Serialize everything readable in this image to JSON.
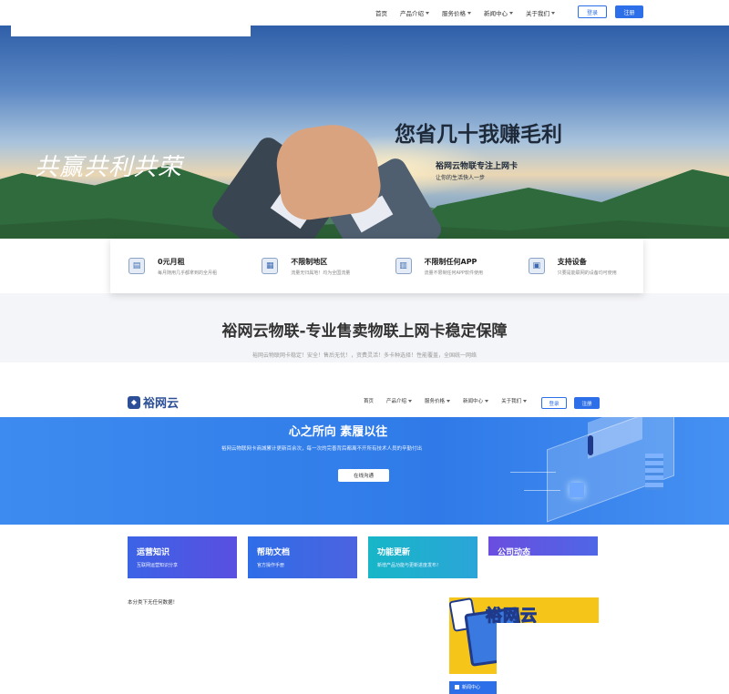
{
  "nav1": {
    "items": [
      {
        "label": "首页",
        "dropdown": false
      },
      {
        "label": "产品介绍",
        "dropdown": true
      },
      {
        "label": "服务价格",
        "dropdown": true
      },
      {
        "label": "新闻中心",
        "dropdown": true
      },
      {
        "label": "关于我们",
        "dropdown": true
      }
    ],
    "login": "登录",
    "register": "注册"
  },
  "hero": {
    "calligraphy": "共赢共利共荣",
    "title": "您省几十我赚毛利",
    "subtitle": "裕网云物联专注上网卡",
    "tagline": "让你的生活快人一步"
  },
  "features": [
    {
      "title": "0元月租",
      "desc": "每月随用几乎都拿到的全月租",
      "icon": "card-icon"
    },
    {
      "title": "不限制地区",
      "desc": "流量无归属地！均为全国流量",
      "icon": "map-icon"
    },
    {
      "title": "不限制任何APP",
      "desc": "流量不限制任何APP软件使用",
      "icon": "app-icon"
    },
    {
      "title": "支持设备",
      "desc": "只要是能联网的设备均可使用",
      "icon": "device-icon"
    }
  ],
  "slogan": {
    "title": "裕网云物联-专业售卖物联上网卡稳定保障",
    "subtitle": "裕网云物联网卡稳定！安全！售后无忧！，资费灵活！多卡种选择！性能覆盖，全国统一网络"
  },
  "site2": {
    "logo": "裕网云",
    "nav": [
      {
        "label": "首页",
        "dropdown": false
      },
      {
        "label": "产品介绍",
        "dropdown": true
      },
      {
        "label": "服务价格",
        "dropdown": true
      },
      {
        "label": "新闻中心",
        "dropdown": true
      },
      {
        "label": "关于我们",
        "dropdown": true
      }
    ],
    "login": "登录",
    "register": "注册",
    "banner": {
      "title": "心之所向 素履以往",
      "desc": "裕网云物联网卡商城累计更新百余次，每一次的完善背后都离不开所有技术人员的辛勤付出",
      "button": "在线沟通"
    },
    "cards": [
      {
        "title": "运营知识",
        "desc": "互联网运营知识分享"
      },
      {
        "title": "帮助文档",
        "desc": "官方操作手册"
      },
      {
        "title": "功能更新",
        "desc": "新增产品功能与更新进度发布！"
      },
      {
        "title": "公司动态",
        "desc": ""
      }
    ],
    "empty_notice": "本分类下无任何数据！",
    "ad_text": "裕网云",
    "ad_footer": "新闻中心"
  },
  "colors": {
    "primary": "#2d6fe8",
    "banner_blue": "#2f7ae8",
    "ad_yellow": "#f5c51a"
  }
}
